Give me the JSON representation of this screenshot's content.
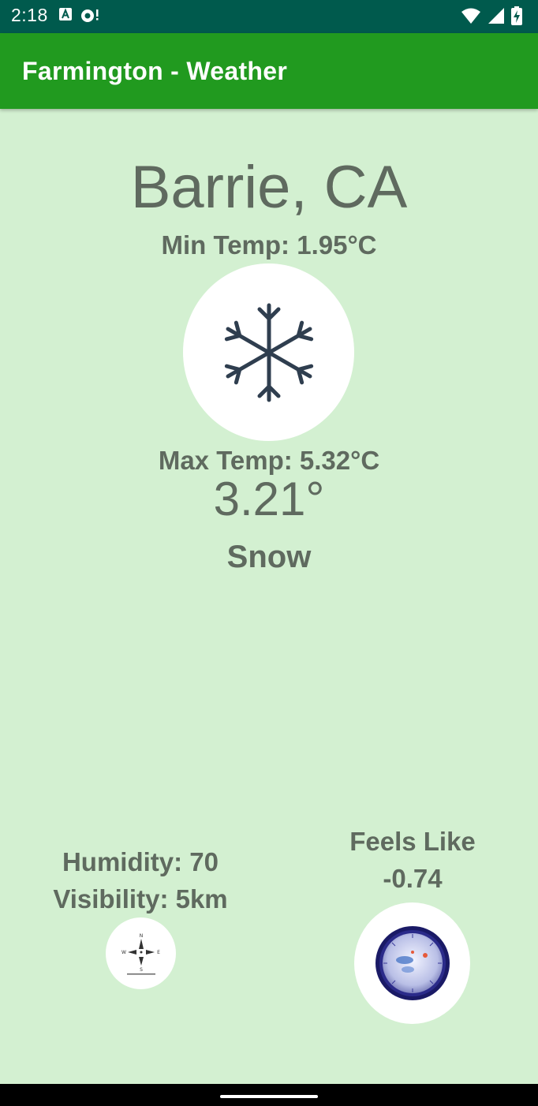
{
  "status_bar": {
    "time": "2:18",
    "left_icons": [
      "text-a-icon",
      "camera-alert-icon"
    ],
    "right_icons": [
      "wifi-icon",
      "cell-signal-icon",
      "battery-charging-icon"
    ]
  },
  "app_bar": {
    "title": "Farmington - Weather"
  },
  "weather": {
    "city": "Barrie, CA",
    "min_temp": "Min Temp: 1.95°C",
    "max_temp": "Max Temp: 5.32°C",
    "temperature": "3.21°",
    "condition": "Snow",
    "condition_icon": "snowflake-icon"
  },
  "details": {
    "humidity": "Humidity: 70",
    "visibility": "Visibility: 5km",
    "feels_like_label": "Feels Like",
    "feels_like_value": "-0.74"
  },
  "colors": {
    "status_bar": "#005a4d",
    "app_bar": "#219a1f",
    "background": "#d3f0d1",
    "text": "#5f6a5f",
    "snowflake": "#2f3e4f"
  }
}
